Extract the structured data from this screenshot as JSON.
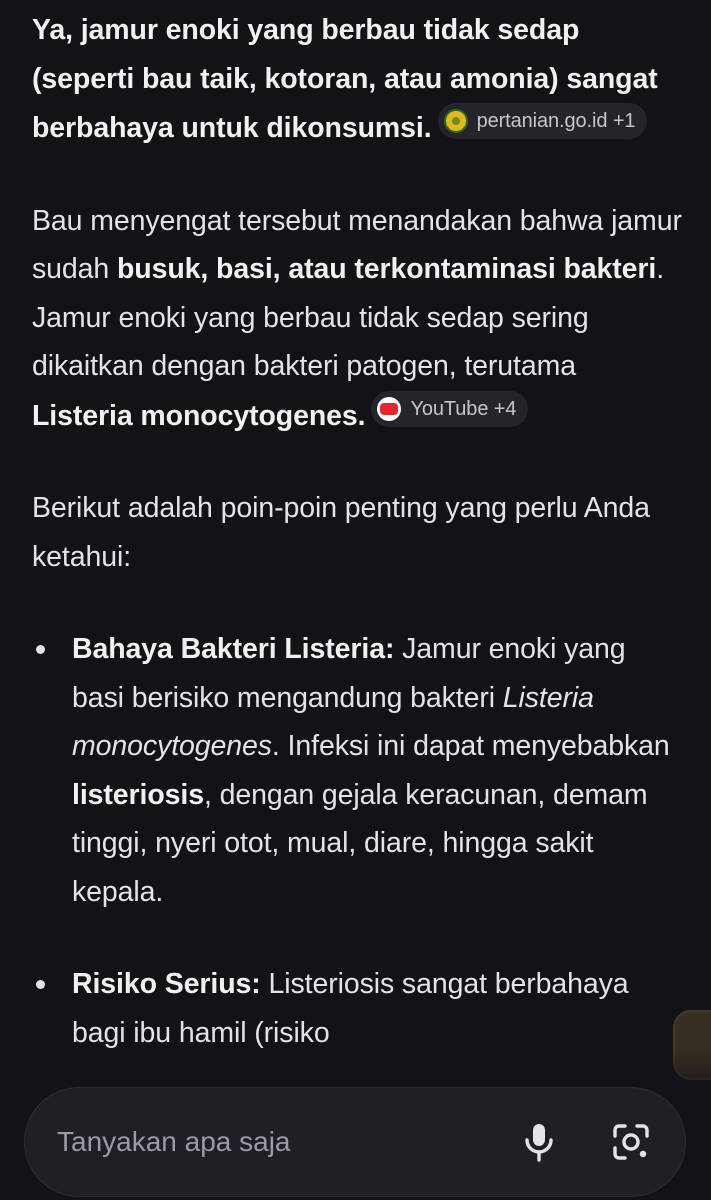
{
  "answer": {
    "intro": {
      "text": "Ya, jamur enoki yang berbau tidak sedap (seperti bau taik, kotoran, atau amonia) sangat berbahaya untuk dikonsumsi.",
      "source_chip": "pertanian.go.id +1",
      "source_icon": "pertanian-logo-icon"
    },
    "para2": {
      "t1": "Bau menyengat tersebut menandakan bahwa jamur sudah ",
      "b1": "busuk, basi, atau terkontaminasi bakteri",
      "t2": ". Jamur enoki yang berbau tidak sedap sering dikaitkan dengan bakteri patogen, terutama ",
      "b2": "Listeria monocytogenes.",
      "source_chip": "YouTube +4",
      "source_icon": "youtube-icon"
    },
    "para3": "Berikut adalah poin-poin penting yang perlu Anda ketahui:",
    "bullets": [
      {
        "title": "Bahaya Bakteri Listeria:",
        "t1": " Jamur enoki yang basi berisiko mengandung bakteri ",
        "italic": "Listeria monocytogenes",
        "t2": ". Infeksi ini dapat menyebabkan ",
        "bold2": "listeriosis",
        "t3": ", dengan gejala keracunan, demam tinggi, nyeri otot, mual, diare, hingga sakit kepala."
      },
      {
        "title": "Risiko Serius:",
        "t1": " Listeriosis sangat berbahaya bagi ibu hamil (risiko"
      }
    ]
  },
  "composer": {
    "placeholder": "Tanyakan apa saja",
    "mic_icon": "microphone-icon",
    "lens_icon": "camera-search-icon"
  },
  "colors": {
    "background": "#131317",
    "text": "#e3e3e8",
    "chip_bg": "#24252a",
    "composer_bg": "#1f1f25"
  }
}
